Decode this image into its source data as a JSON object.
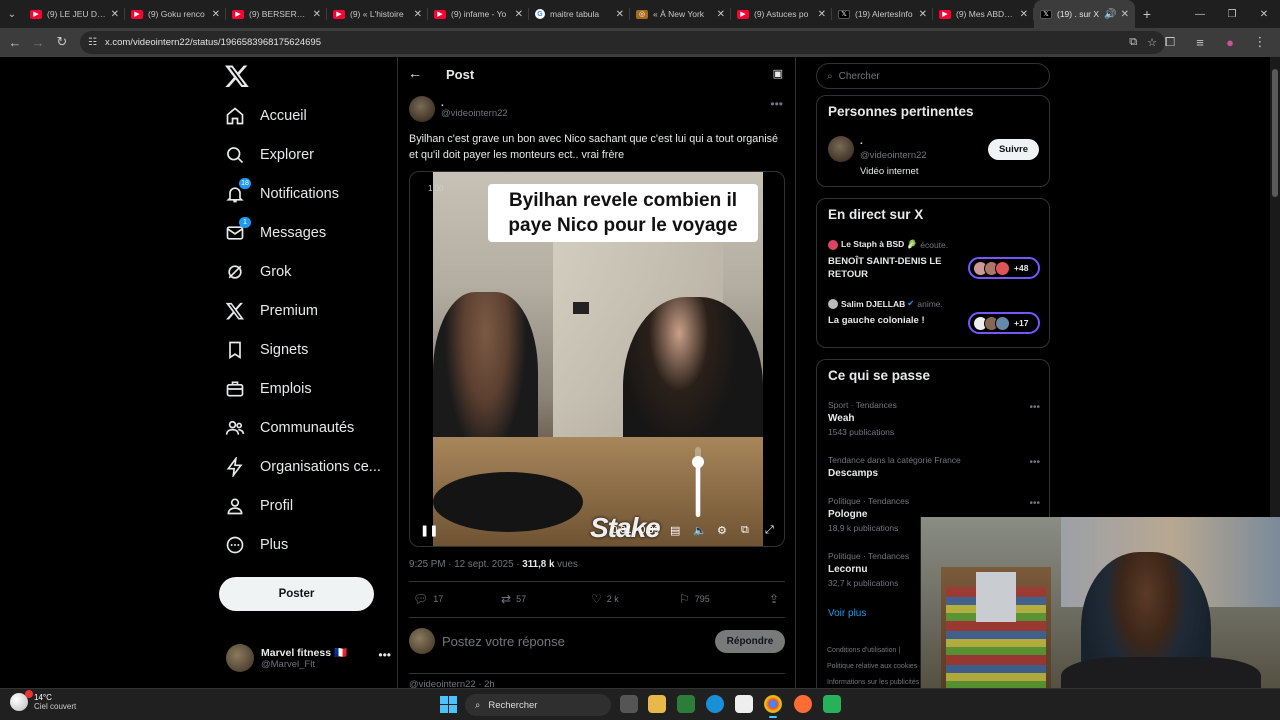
{
  "browser": {
    "tabs": [
      {
        "title": "(9) LE JEU DIGI",
        "icon": "youtube-icon",
        "active": false
      },
      {
        "title": "(9) Goku renco",
        "icon": "youtube-icon",
        "active": false
      },
      {
        "title": "(9) BERSERKOL",
        "icon": "youtube-icon",
        "active": false
      },
      {
        "title": "(9) « L'histoire",
        "icon": "youtube-icon",
        "active": false
      },
      {
        "title": "(9) infame - Yo",
        "icon": "youtube-icon",
        "active": false
      },
      {
        "title": "maitre tabula",
        "icon": "google-icon",
        "active": false
      },
      {
        "title": "« À New York",
        "icon": "news-icon",
        "active": false
      },
      {
        "title": "(9) Astuces po",
        "icon": "youtube-icon",
        "active": false
      },
      {
        "title": "(19) AlertesInfo",
        "icon": "x-icon",
        "active": false
      },
      {
        "title": "(9) Mes ABDOS",
        "icon": "youtube-icon",
        "active": false
      },
      {
        "title": "(19) . sur X",
        "icon": "x-icon",
        "active": true
      }
    ],
    "new_tab": "+",
    "url": "x.com/videointern22/status/1966583968175624695"
  },
  "nav": {
    "items": [
      {
        "label": "Accueil",
        "icon": "home-icon"
      },
      {
        "label": "Explorer",
        "icon": "search-icon"
      },
      {
        "label": "Notifications",
        "icon": "bell-icon",
        "badge": "18"
      },
      {
        "label": "Messages",
        "icon": "envelope-icon",
        "badge": "1"
      },
      {
        "label": "Grok",
        "icon": "grok-icon"
      },
      {
        "label": "Premium",
        "icon": "x-logo-icon"
      },
      {
        "label": "Signets",
        "icon": "bookmark-icon"
      },
      {
        "label": "Emplois",
        "icon": "briefcase-icon"
      },
      {
        "label": "Communautés",
        "icon": "people-icon"
      },
      {
        "label": "Organisations ce...",
        "icon": "lightning-icon"
      },
      {
        "label": "Profil",
        "icon": "person-icon"
      },
      {
        "label": "Plus",
        "icon": "more-circle-icon"
      }
    ],
    "post_button": "Poster",
    "account": {
      "name": "Marvel fitness 🇫🇷",
      "handle": "@Marvel_Flt"
    }
  },
  "post": {
    "header_title": "Post",
    "author_name": ".",
    "author_handle": "@videointern22",
    "text": "Byilhan c'est grave un bon avec Nico sachant que c'est lui qui a tout organisé et qu'il doit payer les monteurs ect.. vrai frère",
    "video": {
      "caption": "Byilhan revele combien il paye Nico pour le voyage",
      "speed": "1.00",
      "watermark": "Stake",
      "time": "0:31 / 0:39",
      "volume_level": 0.85
    },
    "meta_time": "9:25 PM · 12 sept. 2025 · ",
    "meta_views": "311,8 k",
    "meta_views_suffix": " vues",
    "stats": {
      "replies": "17",
      "reposts": "57",
      "likes": "2 k",
      "bookmarks": "795"
    },
    "reply_placeholder": "Postez votre réponse",
    "reply_button": "Répondre",
    "next_reply_preview": "@videointern22 · 2h"
  },
  "sidebar": {
    "search_placeholder": "Chercher",
    "relevant": {
      "title": "Personnes pertinentes",
      "name": ".",
      "handle": "@videointern22",
      "bio": "Vidéo internet",
      "follow": "Suivre"
    },
    "live": {
      "title": "En direct sur X",
      "items": [
        {
          "host": "Le Staph à BSD 🥬",
          "action": "écoute.",
          "title": "BENOÎT SAINT-DENIS LE RETOUR",
          "count": "+48"
        },
        {
          "host": "Salim DJELLAB",
          "action": "anime.",
          "title": "La gauche coloniale !",
          "count": "+17"
        }
      ]
    },
    "trends": {
      "title": "Ce qui se passe",
      "items": [
        {
          "category": "Sport · Tendances",
          "title": "Weah",
          "count": "1543 publications"
        },
        {
          "category": "Tendance dans la catégorie France",
          "title": "Descamps",
          "count": ""
        },
        {
          "category": "Politique · Tendances",
          "title": "Pologne",
          "count": "18,9 k publications"
        },
        {
          "category": "Politique · Tendances",
          "title": "Lecornu",
          "count": "32,7 k publications"
        }
      ],
      "more": "Voir plus"
    },
    "footer": [
      "Conditions d'utilisation |",
      "Politique relative aux cookies",
      "Informations sur les publicités"
    ]
  },
  "taskbar": {
    "temp": "14°C",
    "weather": "Ciel couvert",
    "search": "Rechercher"
  },
  "colors": {
    "accent": "#1d9bf0",
    "live": "#7856ff",
    "bg": "#000000"
  }
}
